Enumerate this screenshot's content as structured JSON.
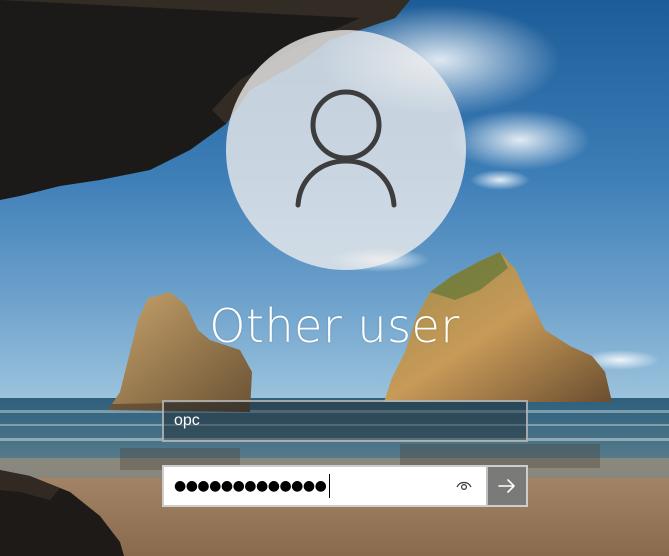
{
  "login": {
    "user_display_name": "Other user",
    "username_value": "opc",
    "password_masked": "●●●●●●●●●●●●●"
  },
  "icons": {
    "avatar": "user-silhouette-icon",
    "reveal": "eye-icon",
    "submit": "arrow-right-icon"
  },
  "colors": {
    "submit_button": "#7a7a78",
    "password_field": "#ffffff",
    "text": "#ffffff"
  }
}
